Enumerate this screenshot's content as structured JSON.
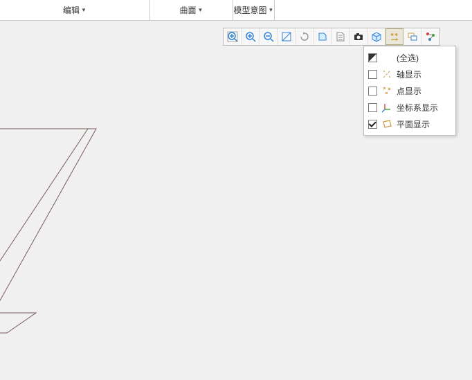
{
  "tabs": {
    "edit": "编辑",
    "surface": "曲面",
    "modelIntent": "模型意图"
  },
  "toolbar": {
    "icons": [
      "zoom-extents-icon",
      "zoom-in-icon",
      "zoom-out-icon",
      "rotate-icon",
      "mesh-icon",
      "plane-icon",
      "notes-icon",
      "snapshot-icon",
      "section-icon",
      "datum-display-icon",
      "layers-icon",
      "network-icon"
    ],
    "activeIndex": 9
  },
  "dropdown": {
    "items": [
      {
        "label": "(全选)",
        "state": "mixed",
        "iconKey": ""
      },
      {
        "label": "轴显示",
        "state": "off",
        "iconKey": "axis"
      },
      {
        "label": "点显示",
        "state": "off",
        "iconKey": "point"
      },
      {
        "label": "坐标系显示",
        "state": "off",
        "iconKey": "csys"
      },
      {
        "label": "平面显示",
        "state": "on",
        "iconKey": "plane"
      }
    ]
  },
  "colors": {
    "wireframe": "#7a5a5a",
    "iconBlue": "#2f82d6",
    "iconAmber": "#c89b3c"
  }
}
